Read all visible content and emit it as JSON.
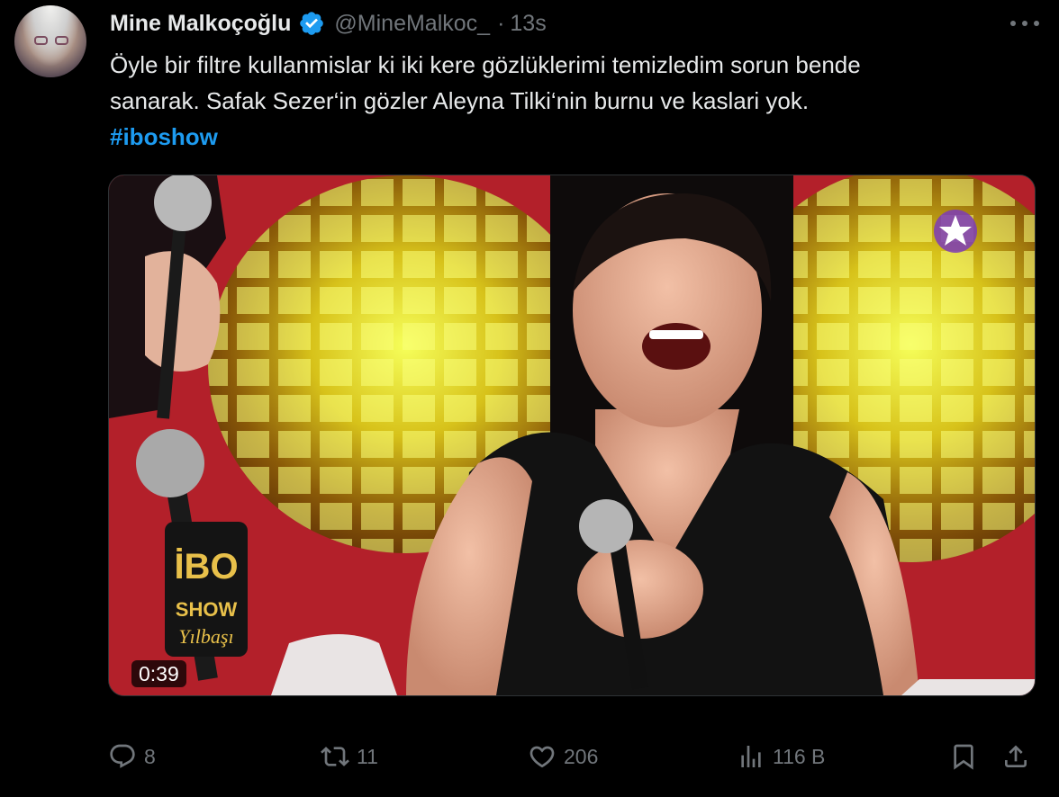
{
  "tweet": {
    "author": {
      "display_name": "Mine Malkoçoğlu",
      "handle": "@MineMalkoc_",
      "verified": true,
      "verified_color": "#1d9bf0"
    },
    "separator": "·",
    "time": "13s",
    "text_lines": [
      "Öyle bir filtre kullanmislar ki iki kere gözlüklerimi temizledim sorun bende",
      "sanarak. Safak Sezer‘in gözler Aleyna Tilki‘nin burnu ve kaslari yok."
    ],
    "hashtag": "#iboshow",
    "hashtag_color": "#1d9bf0",
    "media": {
      "type": "video",
      "duration": "0:39",
      "overlay_logo_text": [
        "İBO",
        "SHOW",
        "Yılbaşı"
      ]
    },
    "actions": {
      "reply": {
        "icon": "reply-icon",
        "count": "8"
      },
      "retweet": {
        "icon": "retweet-icon",
        "count": "11"
      },
      "like": {
        "icon": "heart-icon",
        "count": "206"
      },
      "views": {
        "icon": "views-icon",
        "count": "116 B"
      },
      "bookmark": {
        "icon": "bookmark-icon"
      },
      "share": {
        "icon": "share-icon"
      }
    },
    "more_icon": "more-horizontal-icon"
  }
}
